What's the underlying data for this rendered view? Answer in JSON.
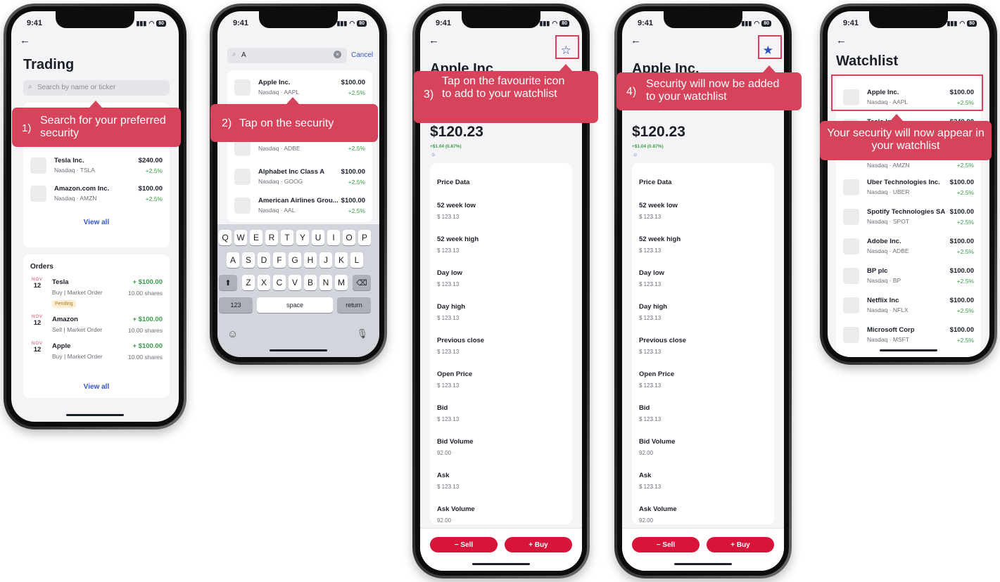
{
  "time": "9:41",
  "battery": "80",
  "phone1": {
    "title": "Trading",
    "search_placeholder": "Search by name or ticker",
    "list": [
      {
        "name": "Tesla Inc.",
        "ticker": "Nasdaq · TSLA",
        "price": "$240.00",
        "change": "+2.5%"
      },
      {
        "name": "Amazon.com Inc.",
        "ticker": "Nasdaq · AMZN",
        "price": "$100.00",
        "change": "+2.5%"
      }
    ],
    "view_all": "View all",
    "orders_title": "Orders",
    "orders": [
      {
        "month": "NOV",
        "day": "12",
        "name": "Tesla",
        "type": "Buy | Market Order",
        "amount": "+ $100.00",
        "shares": "10.00 shares",
        "badge": "Pending"
      },
      {
        "month": "NOV",
        "day": "12",
        "name": "Amazon",
        "type": "Sell | Market Order",
        "amount": "+ $100.00",
        "shares": "10.00 shares"
      },
      {
        "month": "NOV",
        "day": "12",
        "name": "Apple",
        "type": "Buy | Market Order",
        "amount": "+ $100.00",
        "shares": "10.00 shares"
      }
    ],
    "orders_view_all": "View all"
  },
  "phone2": {
    "search_value": "A",
    "cancel": "Cancel",
    "results": [
      {
        "name": "Apple Inc.",
        "ticker": "Nasdaq · AAPL",
        "price": "$100.00",
        "change": "+2.5%"
      },
      {
        "name": "",
        "ticker": "Nasdaq · ADBE",
        "price": "",
        "change": "+2.5%"
      },
      {
        "name": "Alphabet Inc Class A",
        "ticker": "Nasdaq · GOOG",
        "price": "$100.00",
        "change": "+2.5%"
      },
      {
        "name": "American Airlines Grou...",
        "ticker": "Nasdaq · AAL",
        "price": "$100.00",
        "change": "+2.5%"
      }
    ],
    "keyboard": {
      "row1": [
        "Q",
        "W",
        "E",
        "R",
        "T",
        "Y",
        "U",
        "I",
        "O",
        "P"
      ],
      "row2": [
        "A",
        "S",
        "D",
        "F",
        "G",
        "H",
        "J",
        "K",
        "L"
      ],
      "row3": [
        "Z",
        "X",
        "C",
        "V",
        "B",
        "N",
        "M"
      ],
      "num": "123",
      "space": "space",
      "return": "return"
    }
  },
  "detail": {
    "title": "Apple Inc.",
    "price": "$120.23",
    "change": "+$1.04 (0.87%)",
    "price_data_title": "Price Data",
    "fields": [
      {
        "label": "52 week low",
        "value": "$ 123.13"
      },
      {
        "label": "52 week high",
        "value": "$ 123.13"
      },
      {
        "label": "Day low",
        "value": "$ 123.13"
      },
      {
        "label": "Day high",
        "value": "$ 123.13"
      },
      {
        "label": "Previous close",
        "value": "$ 123.13"
      },
      {
        "label": "Open Price",
        "value": "$ 123.13"
      },
      {
        "label": "Bid",
        "value": "$ 123.13"
      },
      {
        "label": "Bid Volume",
        "value": "92.00"
      },
      {
        "label": "Ask",
        "value": "$ 123.13"
      },
      {
        "label": "Ask Volume",
        "value": "92.00"
      }
    ],
    "sell": "− Sell",
    "buy": "+ Buy"
  },
  "phone5": {
    "title": "Watchlist",
    "items": [
      {
        "name": "Apple Inc.",
        "ticker": "Nasdaq · AAPL",
        "price": "$100.00",
        "change": "+2.5%"
      },
      {
        "name": "Tesla Inc.",
        "ticker": "",
        "price": "$240.00",
        "change": ""
      },
      {
        "name": "",
        "ticker": "Nasdaq · AMZN",
        "price": "",
        "change": "+2.5%"
      },
      {
        "name": "Uber Technologies Inc.",
        "ticker": "Nasdaq · UBER",
        "price": "$100.00",
        "change": "+2.5%"
      },
      {
        "name": "Spotify Technologies SA",
        "ticker": "Nasdaq · SPOT",
        "price": "$100.00",
        "change": "+2.5%"
      },
      {
        "name": "Adobe Inc.",
        "ticker": "Nasdaq · ADBE",
        "price": "$100.00",
        "change": "+2.5%"
      },
      {
        "name": "BP plc",
        "ticker": "Nasdaq · BP",
        "price": "$100.00",
        "change": "+2.5%"
      },
      {
        "name": "Netflix Inc",
        "ticker": "Nasdaq · NFLX",
        "price": "$100.00",
        "change": "+2.5%"
      },
      {
        "name": "Microsoft Corp",
        "ticker": "Nasdaq · MSFT",
        "price": "$100.00",
        "change": "+2.5%"
      }
    ]
  },
  "callouts": {
    "c1_num": "1)",
    "c1_text": "Search for your preferred security",
    "c2_num": "2)",
    "c2_text": "Tap on the security",
    "c3_num": "3)",
    "c3_text": "Tap on the favourite icon to add to your watchlist",
    "c4_num": "4)",
    "c4_text": "Security will now be added to your watchlist",
    "c5_text": "Your security will now appear in your watchlist"
  },
  "colors": {
    "accent": "#d6435a",
    "button": "#d8143a",
    "link": "#3558c4",
    "positive": "#3a9c4a"
  }
}
